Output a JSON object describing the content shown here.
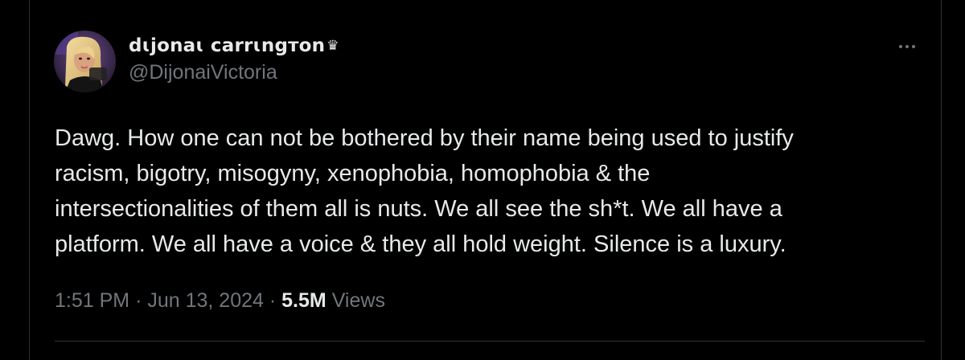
{
  "author": {
    "display_name": "dɩjonaɩ carrɩngтon",
    "crown_icon": "♛",
    "handle": "@DijonaiVictoria",
    "avatar": "profile-photo-woman-blonde-hair"
  },
  "menu": {
    "icon": "more-horizontal-icon"
  },
  "tweet": {
    "lines": [
      "Dawg. How one can not be bothered by their name being used to justify",
      "racism, bigotry, misogyny, xenophobia, homophobia & the",
      "intersectionalities of them all is nuts. We all see the sh*t. We all have a",
      "platform. We all have a voice & they all hold weight. Silence is a luxury."
    ]
  },
  "meta": {
    "time": "1:51 PM",
    "separator": "·",
    "date": "Jun 13, 2024",
    "views_count": "5.5M",
    "views_label": "Views"
  },
  "colors": {
    "background": "#000000",
    "text_primary": "#e7e9ea",
    "text_secondary": "#71767b",
    "border": "#2f3336"
  }
}
